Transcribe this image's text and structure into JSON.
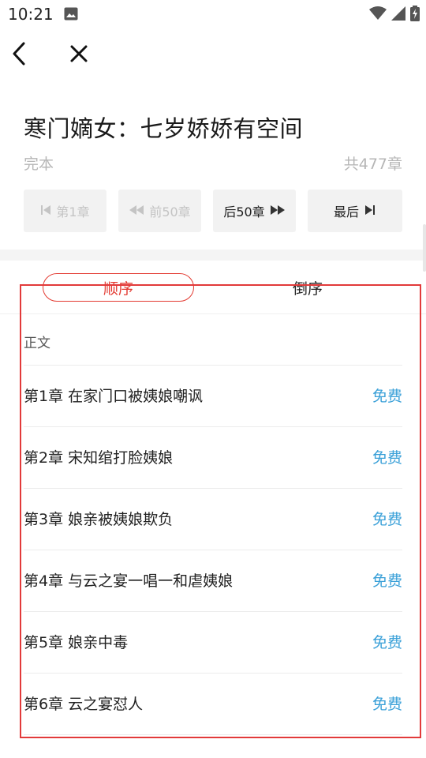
{
  "status_bar": {
    "time": "10:21",
    "icons": [
      "image-icon",
      "wifi-icon",
      "signal-icon",
      "battery-charging-icon"
    ]
  },
  "nav": {
    "back_icon": "back-arrow-icon",
    "close_icon": "close-icon"
  },
  "book": {
    "title": "寒门嫡女：七岁娇娇有空间",
    "status": "完本",
    "chapter_count": "共477章"
  },
  "pager": {
    "first": "第1章",
    "prev": "前50章",
    "next": "后50章",
    "last": "最后"
  },
  "sort_tabs": {
    "asc": "顺序",
    "desc": "倒序",
    "active": "asc",
    "active_color": "#e33b32"
  },
  "section_label": "正文",
  "colors": {
    "accent": "#e33b32",
    "price": "#3aa0d8",
    "highlight_box": "#e23a3a"
  },
  "chapters": [
    {
      "title": "第1章 在家门口被姨娘嘲讽",
      "price": "免费"
    },
    {
      "title": "第2章 宋知绾打脸姨娘",
      "price": "免费"
    },
    {
      "title": "第3章 娘亲被姨娘欺负",
      "price": "免费"
    },
    {
      "title": "第4章 与云之宴一唱一和虐姨娘",
      "price": "免费"
    },
    {
      "title": "第5章 娘亲中毒",
      "price": "免费"
    },
    {
      "title": "第6章 云之宴怼人",
      "price": "免费"
    }
  ]
}
